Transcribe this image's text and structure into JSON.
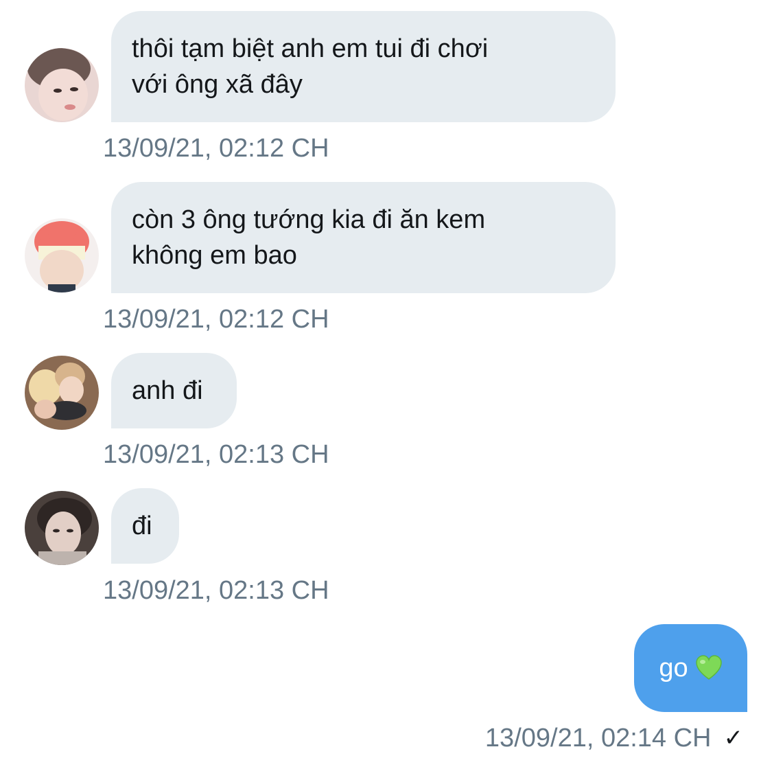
{
  "messages": [
    {
      "sender": "other",
      "avatar": "avatar-photo-1",
      "text": "thôi tạm biệt anh em tui đi chơi\nvới ông xã đây",
      "time": "13/09/21, 02:12 CH"
    },
    {
      "sender": "other",
      "avatar": "avatar-photo-2",
      "text": "còn 3 ông tướng kia đi ăn kem\nkhông em bao",
      "time": "13/09/21, 02:12 CH"
    },
    {
      "sender": "other",
      "avatar": "avatar-photo-3",
      "text": "anh đi",
      "time": "13/09/21, 02:13 CH"
    },
    {
      "sender": "other",
      "avatar": "avatar-photo-4",
      "text": "đi",
      "time": "13/09/21, 02:13 CH"
    },
    {
      "sender": "self",
      "text": "go",
      "emoji": "green-heart-icon",
      "time": "13/09/21, 02:14 CH",
      "status": "✓"
    }
  ],
  "colors": {
    "incoming_bubble": "#e6ecf0",
    "outgoing_bubble": "#4ea0ec",
    "timestamp": "#657786",
    "heart": "#7ed957"
  }
}
